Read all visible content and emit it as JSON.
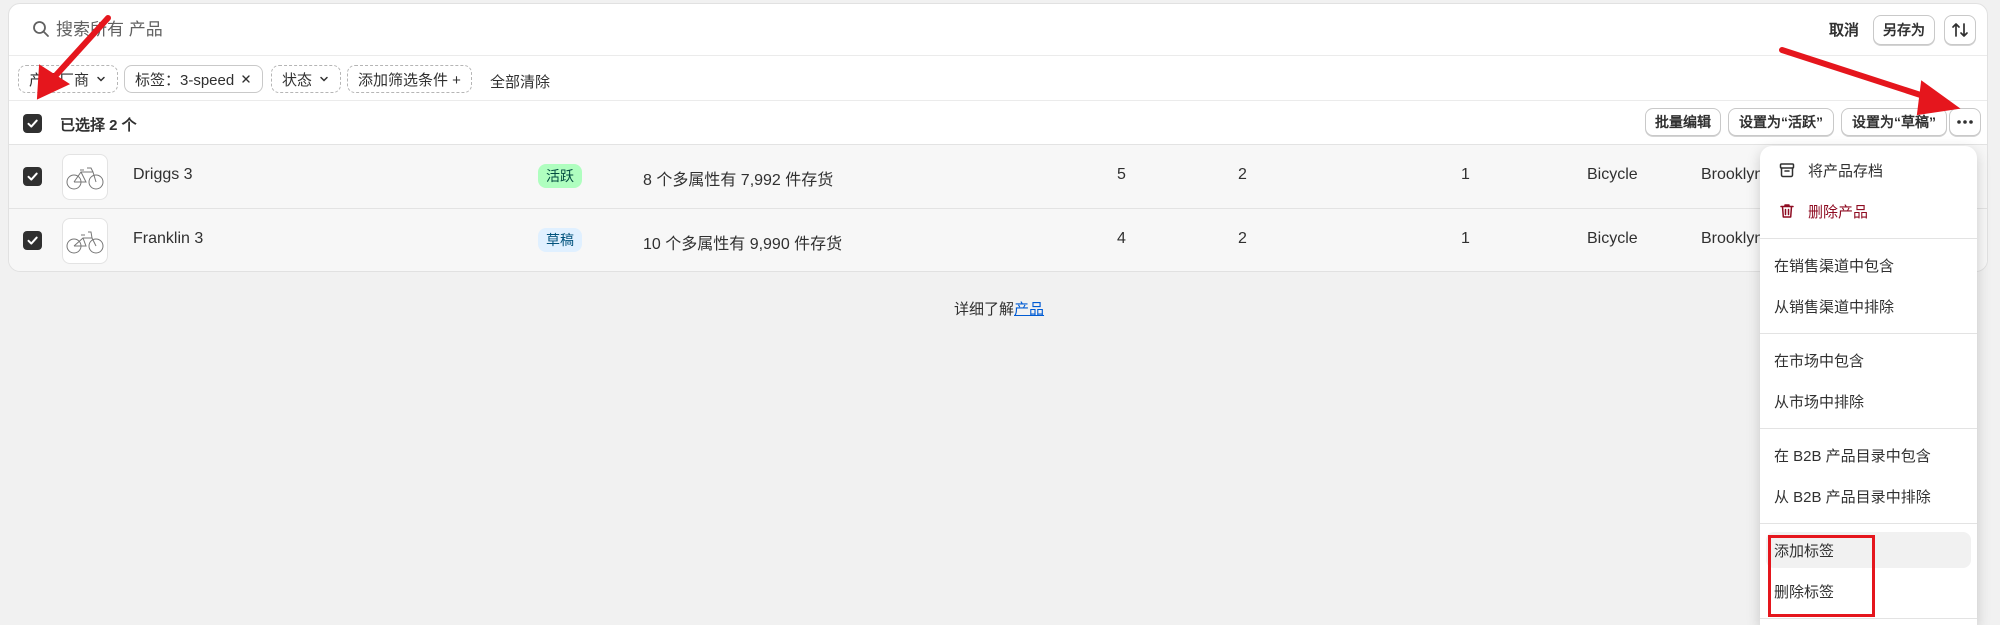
{
  "search": {
    "placeholder": "搜索所有 产品",
    "cancel_label": "取消",
    "save_as_label": "另存为"
  },
  "filters": {
    "vendor_label": "产品厂商",
    "tag_label": "标签：3-speed",
    "status_label": "状态",
    "add_filter_label": "添加筛选条件 +",
    "clear_all_label": "全部清除"
  },
  "bulk": {
    "selected_label": "已选择 2 个",
    "bulk_edit_label": "批量编辑",
    "set_active_label": "设置为“活跃”",
    "set_draft_label": "设置为“草稿”"
  },
  "products": [
    {
      "title": "Driggs 3",
      "status": "活跃",
      "inventory": "8 个多属性有 7,992 件存货",
      "col_a": "5",
      "col_b": "2",
      "col_c": "1",
      "type": "Bicycle",
      "vendor": "Brooklyn"
    },
    {
      "title": "Franklin 3",
      "status": "草稿",
      "inventory": "10 个多属性有 9,990 件存货",
      "col_a": "4",
      "col_b": "2",
      "col_c": "1",
      "type": "Bicycle",
      "vendor": "Brooklyn"
    }
  ],
  "footer": {
    "prefix": "详细了解",
    "link": "产品"
  },
  "menu": {
    "archive": "将产品存档",
    "delete": "删除产品",
    "include_channels": "在销售渠道中包含",
    "exclude_channels": "从销售渠道中排除",
    "include_markets": "在市场中包含",
    "exclude_markets": "从市场中排除",
    "include_b2b": "在 B2B 产品目录中包含",
    "exclude_b2b": "从 B2B 产品目录中排除",
    "add_tags": "添加标签",
    "remove_tags": "删除标签"
  },
  "colors": {
    "active_badge_bg": "#affebf",
    "active_badge_text": "#014b40",
    "draft_badge_bg": "#e0f0ff",
    "draft_badge_text": "#00527c",
    "danger": "#8e0b21",
    "annotation_red": "#e5161d"
  }
}
